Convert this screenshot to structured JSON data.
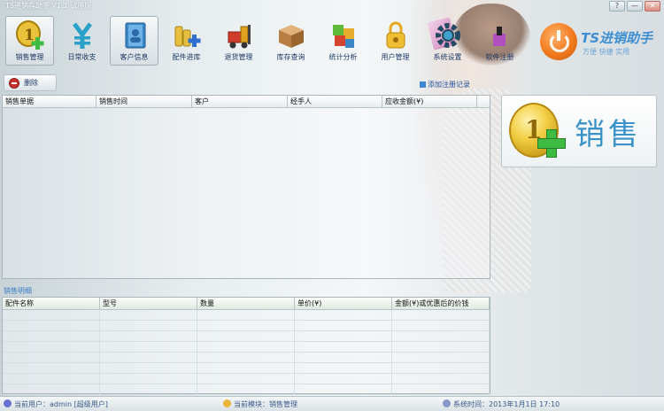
{
  "window": {
    "title": "TS进销存助手 V1.1 试用版",
    "controls": [
      "?",
      "—",
      "✕"
    ]
  },
  "toolbar": [
    {
      "key": "sales",
      "label": "销售管理",
      "icon": "gold-coin-add-icon",
      "active": true
    },
    {
      "key": "daily",
      "label": "日常收支",
      "icon": "yen-icon",
      "active": false
    },
    {
      "key": "customer",
      "label": "客户信息",
      "icon": "folder-contacts-icon",
      "active": true
    },
    {
      "key": "stock_in",
      "label": "配件进库",
      "icon": "coin-stack-add-icon",
      "active": false
    },
    {
      "key": "return",
      "label": "退货管理",
      "icon": "forklift-icon",
      "active": false
    },
    {
      "key": "inventory",
      "label": "库存查询",
      "icon": "boxes-icon",
      "active": false
    },
    {
      "key": "stats",
      "label": "统计分析",
      "icon": "blocks-icon",
      "active": false
    },
    {
      "key": "users",
      "label": "用户管理",
      "icon": "lock-icon",
      "active": false
    },
    {
      "key": "settings",
      "label": "系统设置",
      "icon": "gear-icon",
      "active": false
    },
    {
      "key": "register",
      "label": "软件注册",
      "icon": "register-icon",
      "active": false
    }
  ],
  "brand": {
    "name": "TS进销助手",
    "slogan": "方便  快捷  实用"
  },
  "actions": {
    "delete_label": "删除",
    "hint_link": "添加注册记录"
  },
  "sales_table": {
    "columns": [
      "销售单据",
      "销售时间",
      "客户",
      "经手人",
      "应收金额(¥)"
    ],
    "rows": []
  },
  "detail_section_label": "销售明细",
  "detail_table": {
    "columns": [
      "配件名称",
      "型号",
      "数量",
      "单价(¥)",
      "金额(¥)或优惠后的价钱"
    ],
    "empty_rows": 8
  },
  "sales_panel": {
    "label": "销售"
  },
  "status": {
    "user": "当前用户：admin [超级用户]",
    "module": "当前模块：销售管理",
    "time": "系统时间：2013年1月1日 17:10"
  },
  "colors": {
    "accent": "#3a92c8",
    "link": "#1e4f9a",
    "brand_orange": "#f27a1e"
  }
}
